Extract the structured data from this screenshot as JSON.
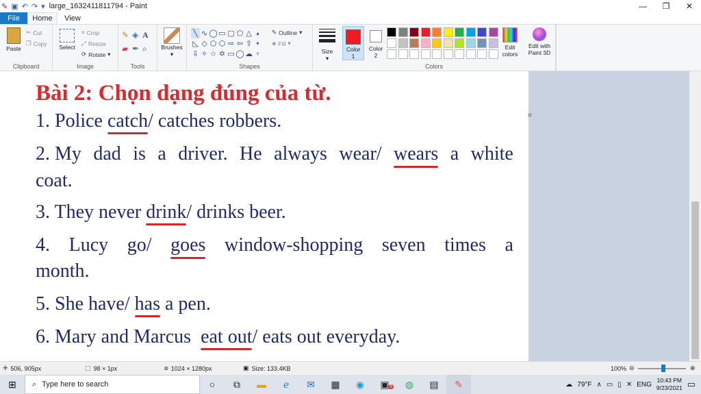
{
  "window": {
    "title": "large_1632411811794 - Paint",
    "quick_access": [
      "save-icon",
      "undo-icon",
      "redo-icon",
      "customize-icon"
    ],
    "controls": {
      "minimize": "—",
      "restore": "❐",
      "close": "✕"
    }
  },
  "menu": {
    "file": "File",
    "tabs": [
      "Home",
      "View"
    ],
    "active_tab": "Home"
  },
  "ribbon": {
    "clipboard": {
      "paste": "Paste",
      "cut": "Cut",
      "copy": "Copy",
      "label": "Clipboard"
    },
    "image": {
      "select": "Select",
      "crop": "Crop",
      "resize": "Resize",
      "rotate": "Rotate",
      "label": "Image"
    },
    "tools": {
      "label": "Tools"
    },
    "brushes": {
      "label": "Brushes"
    },
    "shapes": {
      "outline": "Outline",
      "fill": "Fill",
      "label": "Shapes"
    },
    "size": {
      "label": "Size"
    },
    "color1": {
      "label": "Color\n1",
      "value": "#ee1d24"
    },
    "color2": {
      "label": "Color\n2",
      "value": "#ffffff"
    },
    "colors": {
      "label": "Colors",
      "edit": "Edit colors",
      "palette_row1": [
        "#000000",
        "#7f7f7f",
        "#880015",
        "#ed1c24",
        "#ff7f27",
        "#fff200",
        "#22b14c",
        "#00a2e8",
        "#3f48cc",
        "#a349a4"
      ],
      "palette_row2": [
        "#ffffff",
        "#c3c3c3",
        "#b97a57",
        "#ffaec9",
        "#ffc90e",
        "#efe4b0",
        "#b5e61d",
        "#99d9ea",
        "#7092be",
        "#c8bfe7"
      ],
      "palette_row3": [
        "#ffffff",
        "#ffffff",
        "#ffffff",
        "#ffffff",
        "#ffffff",
        "#ffffff",
        "#ffffff",
        "#ffffff",
        "#ffffff",
        "#ffffff"
      ]
    },
    "paint3d": {
      "label": "Edit with Paint 3D"
    }
  },
  "document": {
    "title": "Bài 2: Chọn dạng đúng của từ.",
    "lines": [
      {
        "parts": [
          "1. Police ",
          "catch",
          "/ catches robbers."
        ],
        "underline": 1
      },
      {
        "parts": [
          "2. My",
          "dad",
          "is",
          "a",
          "driver.",
          "He",
          "always",
          "wear/",
          "wears",
          "a",
          "white"
        ],
        "underline": 8
      },
      {
        "parts": [
          "coat."
        ]
      },
      {
        "parts": [
          "3. They never ",
          "drink",
          "/ drinks beer."
        ],
        "underline": 1
      },
      {
        "parts": [
          "4.",
          "Lucy",
          "go/",
          "goes",
          "window-shopping",
          "seven",
          "times",
          "a"
        ],
        "underline": 3
      },
      {
        "parts": [
          "month."
        ]
      },
      {
        "parts": [
          "5. She have/ ",
          "has",
          " a pen."
        ],
        "underline": 1
      },
      {
        "parts": [
          "6. Mary and Marcus  ",
          "eat out",
          "/ eats out everyday."
        ],
        "underline": 1
      }
    ]
  },
  "status": {
    "cursor": "506, 905px",
    "selection": "98 × 1px",
    "image_size": "1024 × 1280px",
    "file_size": "Size: 133.4KB",
    "zoom": "100%"
  },
  "taskbar": {
    "search_placeholder": "Type here to search",
    "weather": "79°F",
    "language": "ENG",
    "time": "10:43 PM",
    "date": "9/23/2021",
    "mail_badge": "5"
  }
}
